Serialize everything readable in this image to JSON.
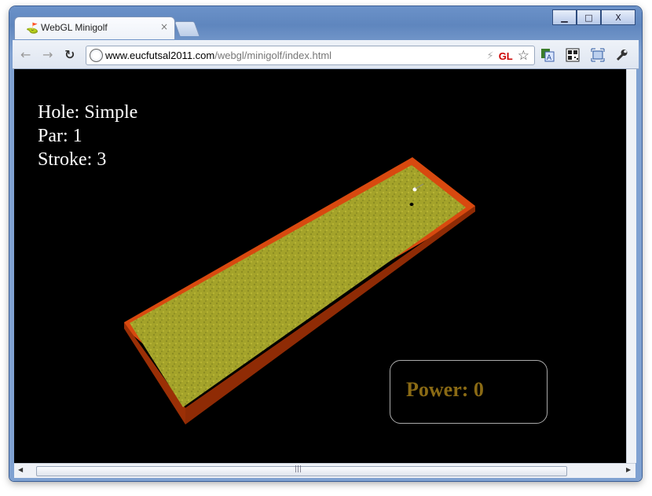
{
  "window": {
    "controls": {
      "minimize": "▁",
      "maximize": "□",
      "close": "X"
    }
  },
  "tab": {
    "title": "WebGL Minigolf",
    "close": "×"
  },
  "toolbar": {
    "back": "←",
    "forward": "→",
    "reload": "↻",
    "url_host": "www.eucfutsal2011.com",
    "url_path": "/webgl/minigolf/index.html",
    "gl_badge": "GL",
    "bolt": "⚡",
    "star": "☆"
  },
  "game": {
    "hole_line": "Hole: Simple",
    "par_line": "Par: 1",
    "stroke_line": "Stroke: 3",
    "power_text": "Power: 0"
  },
  "colors": {
    "wall": "#d8490f",
    "wall_dark": "#9b2f06",
    "grass": "#a7a52a",
    "power_text": "#8a6a14"
  },
  "scroll": {
    "grip": "|||",
    "left": "◀",
    "right": "▶"
  }
}
